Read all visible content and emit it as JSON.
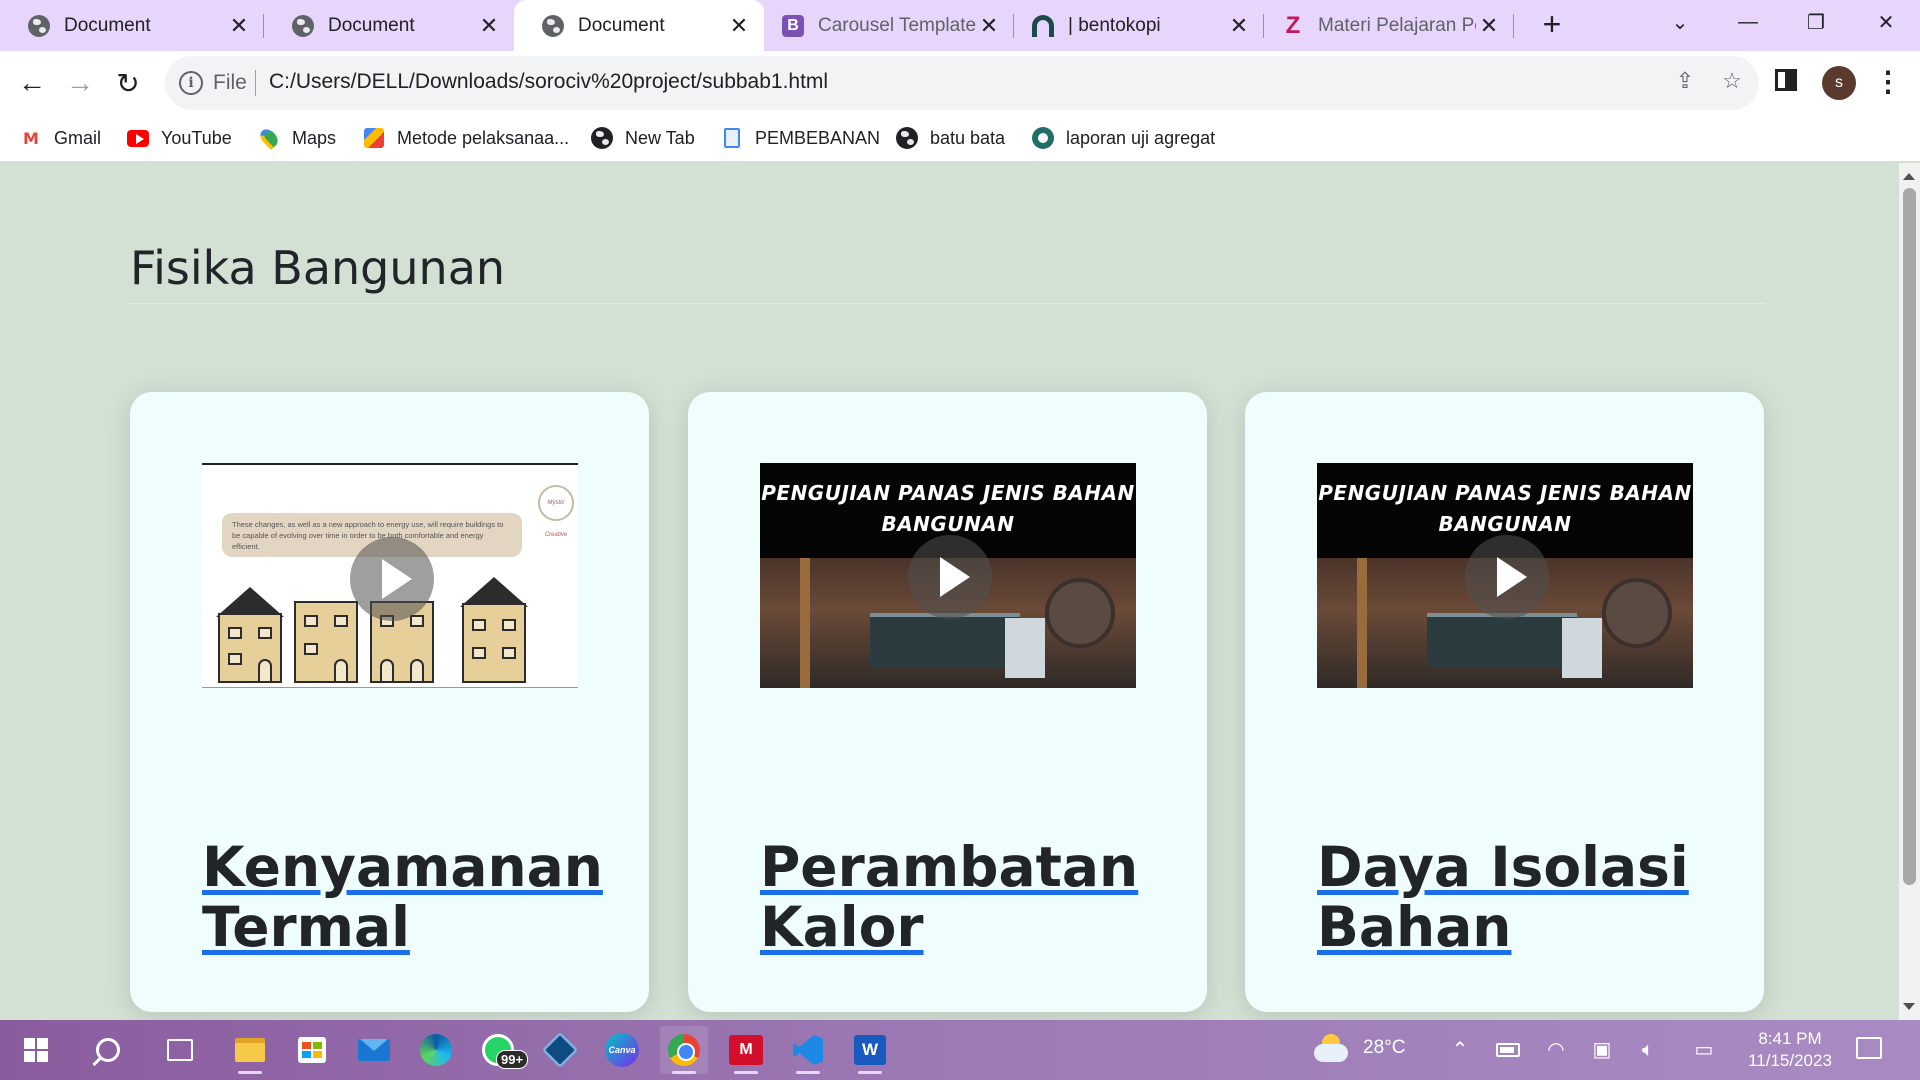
{
  "browser": {
    "tabs": [
      {
        "title": "Document",
        "icon": "globe-icon",
        "active": false
      },
      {
        "title": "Document",
        "icon": "globe-icon",
        "active": false
      },
      {
        "title": "Document",
        "icon": "globe-icon",
        "active": true
      },
      {
        "title": "Carousel Template",
        "icon": "bootstrap-icon",
        "active": false
      },
      {
        "title": "| bentokopi",
        "icon": "arch-icon",
        "active": false
      },
      {
        "title": "Materi Pelajaran Pe",
        "icon": "z-icon",
        "active": false
      }
    ],
    "close_glyph": "✕",
    "new_tab_glyph": "+",
    "tab_search_glyph": "⌄",
    "window": {
      "minimize": "—",
      "restore": "❐",
      "close": "✕"
    }
  },
  "toolbar": {
    "back": "←",
    "forward": "→",
    "reload": "↻",
    "info_glyph": "i",
    "scheme_label": "File",
    "url": "C:/Users/DELL/Downloads/sorociv%20project/subbab1.html",
    "share_glyph": "⇪",
    "star_glyph": "☆",
    "profile_initial": "s",
    "menu_glyph": "⋮"
  },
  "bookmarks": [
    {
      "label": "Gmail",
      "icon": "gmail-icon",
      "glyph": "M"
    },
    {
      "label": "YouTube",
      "icon": "youtube-icon",
      "glyph": ""
    },
    {
      "label": "Maps",
      "icon": "maps-icon",
      "glyph": ""
    },
    {
      "label": "Metode pelaksanaa...",
      "icon": "metode-icon",
      "glyph": ""
    },
    {
      "label": "New Tab",
      "icon": "globe-icon",
      "glyph": ""
    },
    {
      "label": "PEMBEBANAN",
      "icon": "document-icon",
      "glyph": ""
    },
    {
      "label": "batu bata",
      "icon": "globe-icon",
      "glyph": ""
    },
    {
      "label": "laporan uji agregat",
      "icon": "chrome-app-icon",
      "glyph": ""
    }
  ],
  "page": {
    "title": "Fisika Bangunan",
    "cards": [
      {
        "title": "Kenyamanan Termal",
        "video_caption": "These changes, as well as a new approach to energy use, will require buildings to be capable of evolving over time in order to be both comfortable and energy efficient.",
        "video_logo_text": "Mystic Creative"
      },
      {
        "title": "Perambatan Kalor",
        "video_banner": "PENGUJIAN PANAS JENIS BAHAN BANGUNAN"
      },
      {
        "title": "Daya Isolasi Bahan",
        "video_banner": "PENGUJIAN PANAS JENIS BAHAN BANGUNAN"
      }
    ]
  },
  "taskbar": {
    "whatsapp_badge": "99+",
    "canva_label": "Canva",
    "mendeley_label": "M",
    "word_label": "W",
    "temperature": "28°C",
    "time": "8:41 PM",
    "date": "11/15/2023",
    "colors": {
      "accent": "#8a5c9e"
    }
  },
  "colors": {
    "page_bg": "#d3e0d4",
    "card_bg": "#effdfd",
    "link_underline": "#1a6ee6",
    "tabstrip_bg": "#e8d5fb"
  }
}
